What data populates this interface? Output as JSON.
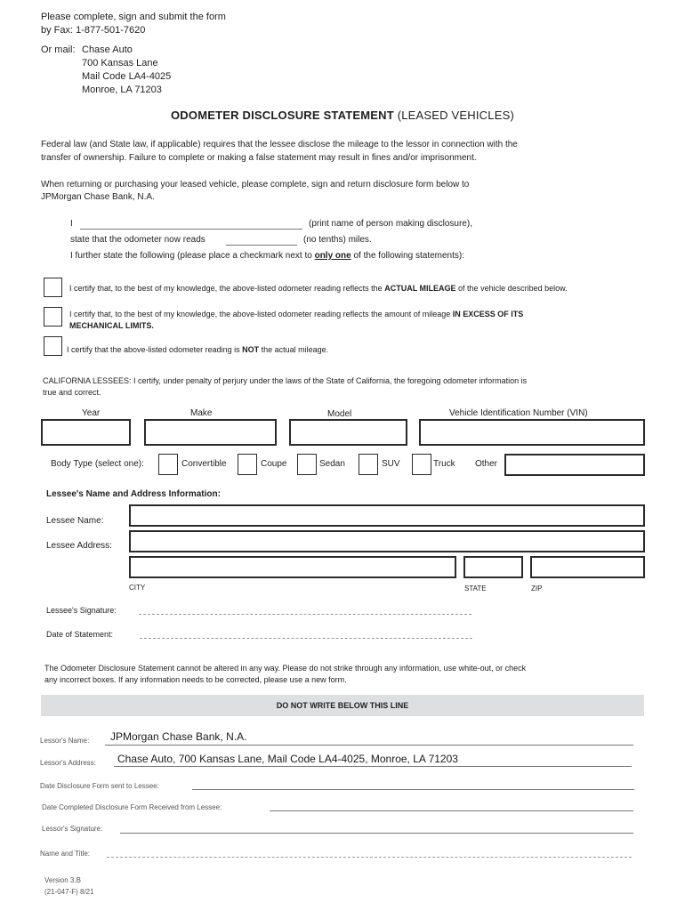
{
  "header": {
    "instruction_line1": "Please complete, sign and submit the form",
    "instruction_line2": "by Fax: 1-877-501-7620",
    "mail_label": "Or mail:",
    "mail_address": [
      "Chase Auto",
      "700 Kansas Lane",
      "Mail Code LA4-4025",
      "Monroe, LA 71203"
    ]
  },
  "title": {
    "bold": "ODOMETER DISCLOSURE STATEMENT",
    "normal": " (LEASED VEHICLES)"
  },
  "intro": {
    "para1_line1": "Federal law (and State law, if applicable) requires that the lessee disclose the mileage to the lessor in connection with the",
    "para1_line2": "transfer of ownership. Failure to complete or making a false statement may result in fines and/or imprisonment.",
    "para2_line1": "When returning or purchasing your leased vehicle, please complete, sign and return disclosure form below to",
    "para2_line2": "JPMorgan Chase Bank, N.A."
  },
  "statement": {
    "line1_prefix": "I",
    "line1_suffix": "(print name of person making disclosure),",
    "line2_prefix": "state that the odometer now reads",
    "line2_suffix": "(no tenths) miles.",
    "line3_prefix": "I further state the following (please place a checkmark next to ",
    "line3_emphasis": "only one",
    "line3_suffix": " of the following statements):"
  },
  "certifications": [
    {
      "pre": "I certify that, to the best of my knowledge, the above-listed odometer reading reflects the ",
      "bold": "ACTUAL MILEAGE",
      "post": " of the vehicle described below.",
      "checked": false
    },
    {
      "pre": "I certify that, to the best of my knowledge, the above-listed odometer reading reflects the amount of mileage ",
      "bold": "IN EXCESS OF ITS",
      "bold2": "MECHANICAL LIMITS.",
      "checked": false
    },
    {
      "pre": "I certify that the above-listed odometer reading is ",
      "bold": "NOT",
      "post": " the actual mileage.",
      "checked": false
    }
  ],
  "california": {
    "line1": "CALIFORNIA LESSEES: I certify, under penalty of perjury under the laws of the State of California, the foregoing odometer information is",
    "line2": "true and correct."
  },
  "vehicle": {
    "year_label": "Year",
    "year_value": "",
    "make_label": "Make",
    "make_value": "",
    "model_label": "Model",
    "model_value": "",
    "vin_label": "Vehicle Identification Number (VIN)",
    "vin_value": ""
  },
  "body_type": {
    "label": "Body Type (select one):",
    "options": [
      "Convertible",
      "Coupe",
      "Sedan",
      "SUV",
      "Truck"
    ],
    "other_label": "Other",
    "other_value": ""
  },
  "lessee": {
    "section_title": "Lessee's Name and Address Information:",
    "name_label": "Lessee Name:",
    "name_value": "",
    "address_label": "Lessee Address:",
    "address_value": "",
    "city_label": "CITY",
    "city_value": "",
    "state_label": "STATE",
    "state_value": "",
    "zip_label": "ZIP",
    "zip_value": "",
    "signature_label": "Lessee's Signature:",
    "date_label": "Date of Statement:"
  },
  "notice": {
    "line1": "The Odometer Disclosure Statement cannot be altered in any way.  Please do not strike through any information, use white-out, or check",
    "line2": "any incorrect boxes.  If any information needs to be corrected, please use a new form."
  },
  "banner": "DO NOT WRITE BELOW THIS LINE",
  "lessor": {
    "name_label": "Lessor's Name:",
    "name_value": "JPMorgan Chase Bank, N.A.",
    "address_label": "Lessor's Address:",
    "address_value": "Chase Auto, 700 Kansas Lane, Mail Code LA4-4025, Monroe, LA 71203",
    "date_sent_label": "Date Disclosure Form sent to Lessee:",
    "date_received_label": "Date Completed Disclosure Form Received from Lessee:",
    "signature_label": "Lessor's Signature:",
    "name_title_label": "Name and Title:"
  },
  "footer": {
    "version": "Version 3.B",
    "form_code": "(21-047-F) 8/21"
  }
}
